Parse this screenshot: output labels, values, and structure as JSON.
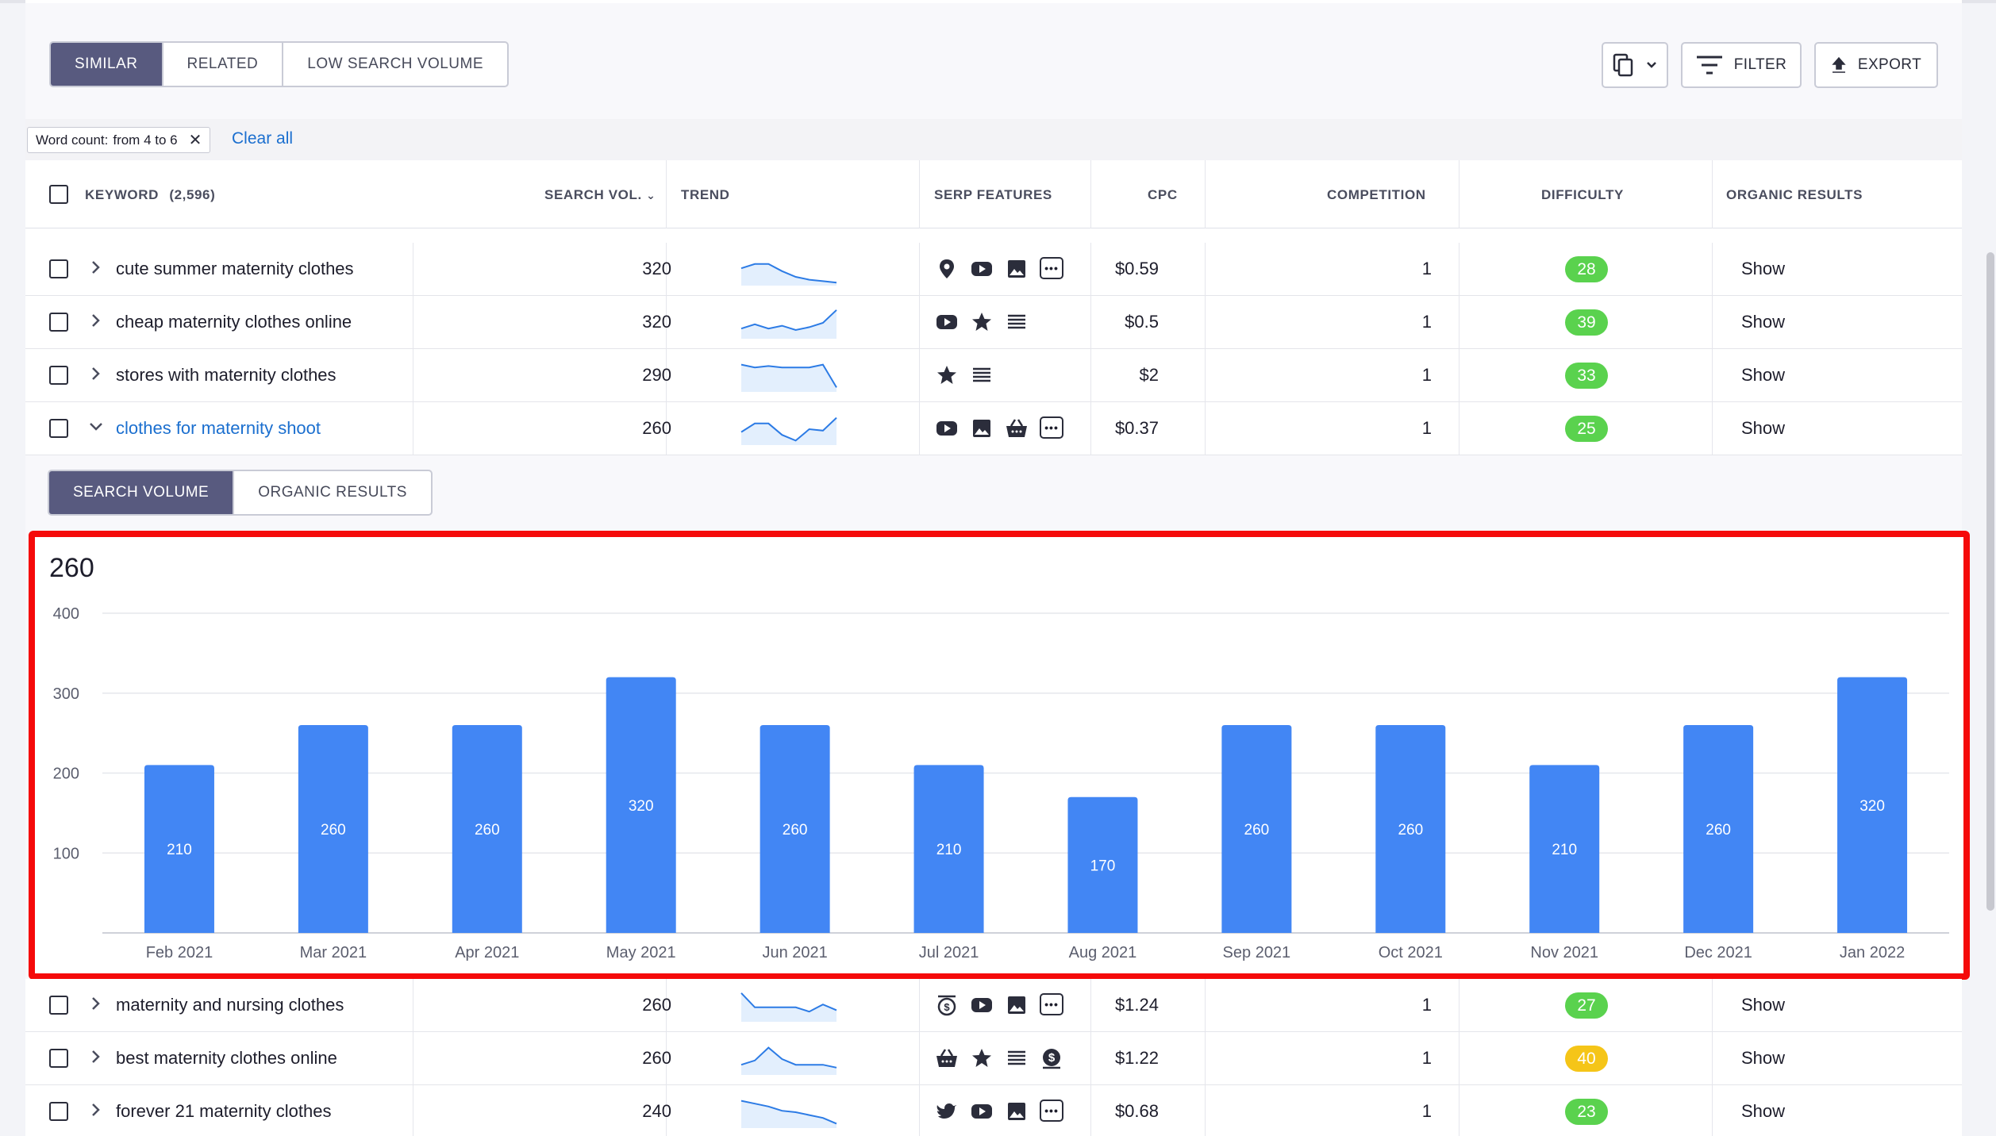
{
  "tabs": [
    {
      "label": "SIMILAR",
      "active": true
    },
    {
      "label": "RELATED",
      "active": false
    },
    {
      "label": "LOW SEARCH VOLUME",
      "active": false
    }
  ],
  "toolbar": {
    "filter_label": "FILTER",
    "export_label": "EXPORT"
  },
  "filter_chip": {
    "key": "Word count:",
    "value": "from 4 to 6"
  },
  "clear_all": "Clear all",
  "columns": {
    "keyword": "KEYWORD",
    "keyword_count": "(2,596)",
    "search_vol": "SEARCH VOL.",
    "trend": "TREND",
    "serp": "SERP FEATURES",
    "cpc": "CPC",
    "competition": "COMPETITION",
    "difficulty": "DIFFICULTY",
    "organic": "ORGANIC RESULTS"
  },
  "rows_top": [
    {
      "keyword": "cute summer maternity clothes",
      "volume": "320",
      "cpc": "$0.59",
      "competition": "1",
      "difficulty": "28",
      "diff_color": "#5ad24e",
      "show": "Show",
      "serp": [
        "pin-icon",
        "youtube-icon",
        "image-icon",
        "more-icon"
      ],
      "trend": [
        0.45,
        0.3,
        0.3,
        0.55,
        0.75,
        0.85,
        0.9,
        0.95
      ]
    },
    {
      "keyword": "cheap maternity clothes online",
      "volume": "320",
      "cpc": "$0.5",
      "competition": "1",
      "difficulty": "39",
      "diff_color": "#5ad24e",
      "show": "Show",
      "serp": [
        "youtube-icon",
        "star-icon",
        "list-icon"
      ],
      "trend": [
        0.7,
        0.55,
        0.7,
        0.6,
        0.75,
        0.65,
        0.5,
        0.05
      ]
    },
    {
      "keyword": "stores with maternity clothes",
      "volume": "290",
      "cpc": "$2",
      "competition": "1",
      "difficulty": "33",
      "diff_color": "#5ad24e",
      "show": "Show",
      "serp": [
        "star-icon",
        "list-icon"
      ],
      "trend": [
        0.1,
        0.2,
        0.15,
        0.2,
        0.2,
        0.2,
        0.1,
        0.9
      ]
    },
    {
      "keyword": "clothes for maternity shoot",
      "volume": "260",
      "cpc": "$0.37",
      "competition": "1",
      "difficulty": "25",
      "diff_color": "#5ad24e",
      "show": "Show",
      "serp": [
        "youtube-icon",
        "image-icon",
        "basket-icon",
        "more-icon"
      ],
      "trend": [
        0.6,
        0.3,
        0.3,
        0.7,
        0.9,
        0.5,
        0.55,
        0.1
      ],
      "expanded": true
    }
  ],
  "detail_tabs": [
    {
      "label": "SEARCH VOLUME",
      "active": true
    },
    {
      "label": "ORGANIC RESULTS",
      "active": false
    }
  ],
  "chart_data": {
    "type": "bar",
    "title": "260",
    "categories": [
      "Feb 2021",
      "Mar 2021",
      "Apr 2021",
      "May 2021",
      "Jun 2021",
      "Jul 2021",
      "Aug 2021",
      "Sep 2021",
      "Oct 2021",
      "Nov 2021",
      "Dec 2021",
      "Jan 2022"
    ],
    "values": [
      210,
      260,
      260,
      320,
      260,
      210,
      170,
      260,
      260,
      210,
      260,
      320
    ],
    "yticks": [
      100,
      200,
      300,
      400
    ],
    "ylim": [
      0,
      400
    ],
    "grid": true,
    "bar_color": "#4286f4"
  },
  "rows_bottom": [
    {
      "keyword": "maternity and nursing clothes",
      "volume": "260",
      "cpc": "$1.24",
      "competition": "1",
      "difficulty": "27",
      "diff_color": "#5ad24e",
      "show": "Show",
      "serp": [
        "dollar-stack-icon",
        "youtube-icon",
        "image-icon",
        "more-icon"
      ],
      "trend": [
        0.05,
        0.55,
        0.55,
        0.55,
        0.55,
        0.7,
        0.45,
        0.65
      ]
    },
    {
      "keyword": "best maternity clothes online",
      "volume": "260",
      "cpc": "$1.22",
      "competition": "1",
      "difficulty": "40",
      "diff_color": "#f5c518",
      "show": "Show",
      "serp": [
        "basket-icon",
        "star-icon",
        "list-icon",
        "dollar-icon"
      ],
      "trend": [
        0.7,
        0.55,
        0.1,
        0.5,
        0.7,
        0.7,
        0.7,
        0.8
      ]
    },
    {
      "keyword": "forever 21 maternity clothes",
      "volume": "240",
      "cpc": "$0.68",
      "competition": "1",
      "difficulty": "23",
      "diff_color": "#5ad24e",
      "show": "Show",
      "serp": [
        "twitter-icon",
        "youtube-icon",
        "image-icon",
        "more-icon"
      ],
      "trend": [
        0.1,
        0.2,
        0.3,
        0.45,
        0.5,
        0.6,
        0.7,
        0.9
      ]
    }
  ]
}
